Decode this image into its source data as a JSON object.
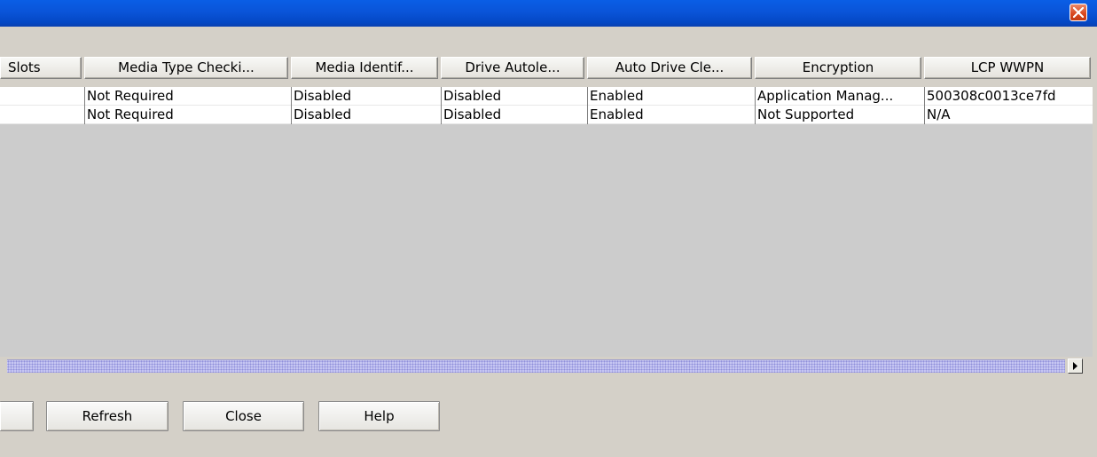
{
  "window": {
    "close_icon": "close-x-icon"
  },
  "table": {
    "columns": [
      {
        "label": "Slots"
      },
      {
        "label": "Media Type Checki..."
      },
      {
        "label": "Media Identif..."
      },
      {
        "label": "Drive Autole..."
      },
      {
        "label": "Auto Drive Cle..."
      },
      {
        "label": "Encryption"
      },
      {
        "label": "LCP WWPN"
      }
    ],
    "rows": [
      {
        "cells": [
          "",
          "Not Required",
          "Disabled",
          "Disabled",
          "Enabled",
          "Application Manag...",
          "500308c0013ce7fd"
        ]
      },
      {
        "cells": [
          "",
          "Not Required",
          "Disabled",
          "Disabled",
          "Enabled",
          "Not Supported",
          "N/A"
        ]
      }
    ]
  },
  "scrollbar": {
    "right_arrow_icon": "arrow-right-icon"
  },
  "buttons": {
    "partial_label": "",
    "refresh_label": "Refresh",
    "close_label": "Close",
    "help_label": "Help"
  },
  "colors": {
    "titlebar": "#0a54d8",
    "background": "#d4d0c8",
    "empty_table_area": "#cccccc",
    "scroll_track": "#c6c6f2"
  }
}
